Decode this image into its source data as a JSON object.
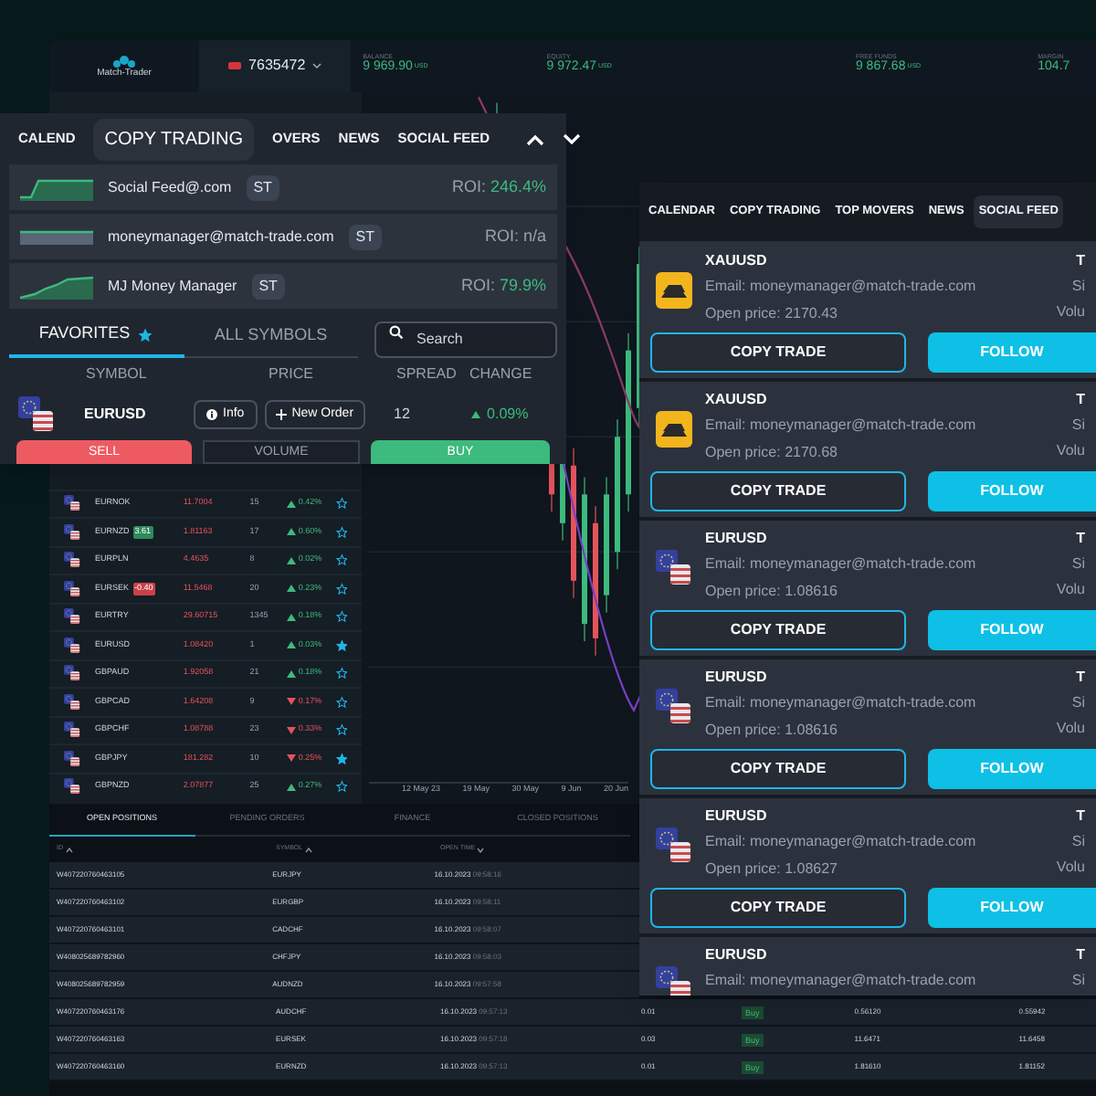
{
  "header": {
    "logo": "Match-Trader",
    "account": "7635472",
    "stats": [
      {
        "label": "BALANCE",
        "value": "9 969.90",
        "currency": "USD"
      },
      {
        "label": "EQUITY",
        "value": "9 972.47",
        "currency": "USD"
      },
      {
        "label": "FREE FUNDS",
        "value": "9 867.68",
        "currency": "USD"
      },
      {
        "label": "MARGIN",
        "value": "104.7"
      }
    ]
  },
  "symbol_list": {
    "rows": [
      {
        "symbol": "EURNOK",
        "price": "11.7004",
        "spread": "15",
        "rising": true,
        "change": "0.42%",
        "favorite": false
      },
      {
        "symbol": "EURNZD",
        "badge": {
          "text": "3.61",
          "kind": "positive"
        },
        "price": "1.81163",
        "spread": "17",
        "rising": true,
        "change": "0.60%",
        "favorite": false
      },
      {
        "symbol": "EURPLN",
        "price": "4.4635",
        "spread": "8",
        "rising": true,
        "change": "0.02%",
        "favorite": false
      },
      {
        "symbol": "EURSEK",
        "badge": {
          "text": "-0.40",
          "kind": "negative"
        },
        "price": "11.5468",
        "spread": "20",
        "rising": true,
        "change": "0.23%",
        "favorite": false
      },
      {
        "symbol": "EURTRY",
        "price": "29.60715",
        "spread": "1345",
        "rising": true,
        "change": "0.18%",
        "favorite": false
      },
      {
        "symbol": "EURUSD",
        "price": "1.08420",
        "spread": "1",
        "rising": true,
        "change": "0.03%",
        "favorite": true
      },
      {
        "symbol": "GBPAUD",
        "price": "1.92058",
        "spread": "21",
        "rising": true,
        "change": "0.18%",
        "favorite": false
      },
      {
        "symbol": "GBPCAD",
        "price": "1.64208",
        "spread": "9",
        "rising": false,
        "change": "0.17%",
        "favorite": false
      },
      {
        "symbol": "GBPCHF",
        "price": "1.08788",
        "spread": "23",
        "rising": false,
        "change": "0.33%",
        "favorite": false
      },
      {
        "symbol": "GBPJPY",
        "price": "181.282",
        "spread": "10",
        "rising": false,
        "change": "0.25%",
        "favorite": true
      },
      {
        "symbol": "GBPNZD",
        "price": "2.07877",
        "spread": "25",
        "rising": true,
        "change": "0.27%",
        "favorite": false
      }
    ]
  },
  "chart": {
    "xlabels": [
      "12 May 23",
      "19 May",
      "30 May",
      "9 Jun",
      "20 Jun"
    ]
  },
  "positions": {
    "tabs": [
      {
        "label": "OPEN POSITIONS",
        "selected": true
      },
      {
        "label": "PENDING ORDERS",
        "selected": false
      },
      {
        "label": "FINANCE",
        "selected": false
      },
      {
        "label": "CLOSED POSITIONS",
        "selected": false
      }
    ],
    "columns": [
      {
        "label": "ID",
        "ascending": true
      },
      {
        "label": "SYMBOL",
        "ascending": true
      },
      {
        "label": "OPEN TIME",
        "ascending": false
      }
    ],
    "rows": [
      {
        "id": "W407220760463105",
        "symbol": "EURJPY",
        "date": "16.10.2023",
        "time": "09:58:16"
      },
      {
        "id": "W407220760463102",
        "symbol": "EURGBP",
        "date": "16.10.2023",
        "time": "09:58:11"
      },
      {
        "id": "W407220760463101",
        "symbol": "CADCHF",
        "date": "16.10.2023",
        "time": "09:58:07"
      },
      {
        "id": "W408025689782960",
        "symbol": "CHFJPY",
        "date": "16.10.2023",
        "time": "09:58:03"
      },
      {
        "id": "W408025689782959",
        "symbol": "AUDNZD",
        "date": "16.10.2023",
        "time": "09:57:58"
      },
      {
        "id": "W407220760463176",
        "symbol": "AUDCHF",
        "date": "16.10.2023",
        "time": "09:57:13",
        "volume": "0.01",
        "side": "Buy",
        "open_price": "0.56120",
        "current_price": "0.55942"
      },
      {
        "id": "W407220760463163",
        "symbol": "EURSEK",
        "date": "16.10.2023",
        "time": "09:57:18",
        "volume": "0.03",
        "side": "Buy",
        "open_price": "11.6471",
        "current_price": "11.6458"
      },
      {
        "id": "W407220760463160",
        "symbol": "EURNZD",
        "date": "16.10.2023",
        "time": "09:57:13",
        "volume": "0.01",
        "side": "Buy",
        "open_price": "1.81610",
        "current_price": "1.81152"
      }
    ]
  },
  "copy_panel": {
    "tabs": [
      {
        "label": "CALEND",
        "selected": false
      },
      {
        "label": "COPY TRADING",
        "selected": true
      },
      {
        "label": "OVERS",
        "selected": false
      },
      {
        "label": "NEWS",
        "selected": false
      },
      {
        "label": "SOCIAL FEED",
        "selected": false
      }
    ],
    "strategies": [
      {
        "name": "Social Feed@.com",
        "badge": "ST",
        "roi_label": "ROI:",
        "roi": "246.4%",
        "positive": true
      },
      {
        "name": "moneymanager@match-trade.com",
        "badge": "ST",
        "roi_label": "ROI:",
        "roi": "n/a",
        "positive": false
      },
      {
        "name": "MJ Money Manager",
        "badge": "ST",
        "roi_label": "ROI:",
        "roi": "79.9%",
        "positive": true
      }
    ],
    "symbol_tabs": [
      {
        "label": "FAVORITES",
        "selected": true
      },
      {
        "label": "ALL SYMBOLS",
        "selected": false
      }
    ],
    "search": {
      "placeholder": "Search"
    },
    "columns": [
      "SYMBOL",
      "PRICE",
      "SPREAD",
      "CHANGE"
    ],
    "row": {
      "symbol": "EURUSD",
      "info": "Info",
      "new_order": "New Order",
      "spread": "12",
      "rising": true,
      "change": "0.09%"
    },
    "sell": "SELL",
    "volume": "VOLUME",
    "buy": "BUY"
  },
  "social_panel": {
    "tabs": [
      {
        "label": "CALENDAR",
        "selected": false
      },
      {
        "label": "COPY TRADING",
        "selected": false
      },
      {
        "label": "TOP MOVERS",
        "selected": false
      },
      {
        "label": "NEWS",
        "selected": false
      },
      {
        "label": "SOCIAL FEED",
        "selected": true
      }
    ],
    "cards": [
      {
        "kind": "gold",
        "symbol": "XAUUSD",
        "email": "Email: moneymanager@match-trade.com",
        "open_price": "Open price: 2170.43",
        "side_labels": [
          "T",
          "Si",
          "Volu"
        ],
        "copy": "COPY TRADE",
        "follow": "FOLLOW"
      },
      {
        "kind": "gold",
        "symbol": "XAUUSD",
        "email": "Email: moneymanager@match-trade.com",
        "open_price": "Open price: 2170.68",
        "side_labels": [
          "T",
          "Si",
          "Volu"
        ],
        "copy": "COPY TRADE",
        "follow": "FOLLOW"
      },
      {
        "kind": "currency",
        "symbol": "EURUSD",
        "email": "Email: moneymanager@match-trade.com",
        "open_price": "Open price: 1.08616",
        "side_labels": [
          "T",
          "Si",
          "Volu"
        ],
        "copy": "COPY TRADE",
        "follow": "FOLLOW"
      },
      {
        "kind": "currency",
        "symbol": "EURUSD",
        "email": "Email: moneymanager@match-trade.com",
        "open_price": "Open price: 1.08616",
        "side_labels": [
          "T",
          "Si",
          "Volu"
        ],
        "copy": "COPY TRADE",
        "follow": "FOLLOW"
      },
      {
        "kind": "currency",
        "symbol": "EURUSD",
        "email": "Email: moneymanager@match-trade.com",
        "open_price": "Open price: 1.08627",
        "side_labels": [
          "T",
          "Si",
          "Volu"
        ],
        "copy": "COPY TRADE",
        "follow": "FOLLOW"
      },
      {
        "kind": "currency",
        "symbol": "EURUSD",
        "email": "Email: moneymanager@match-trade.com",
        "side_labels": [
          "T",
          "Si"
        ]
      }
    ]
  }
}
